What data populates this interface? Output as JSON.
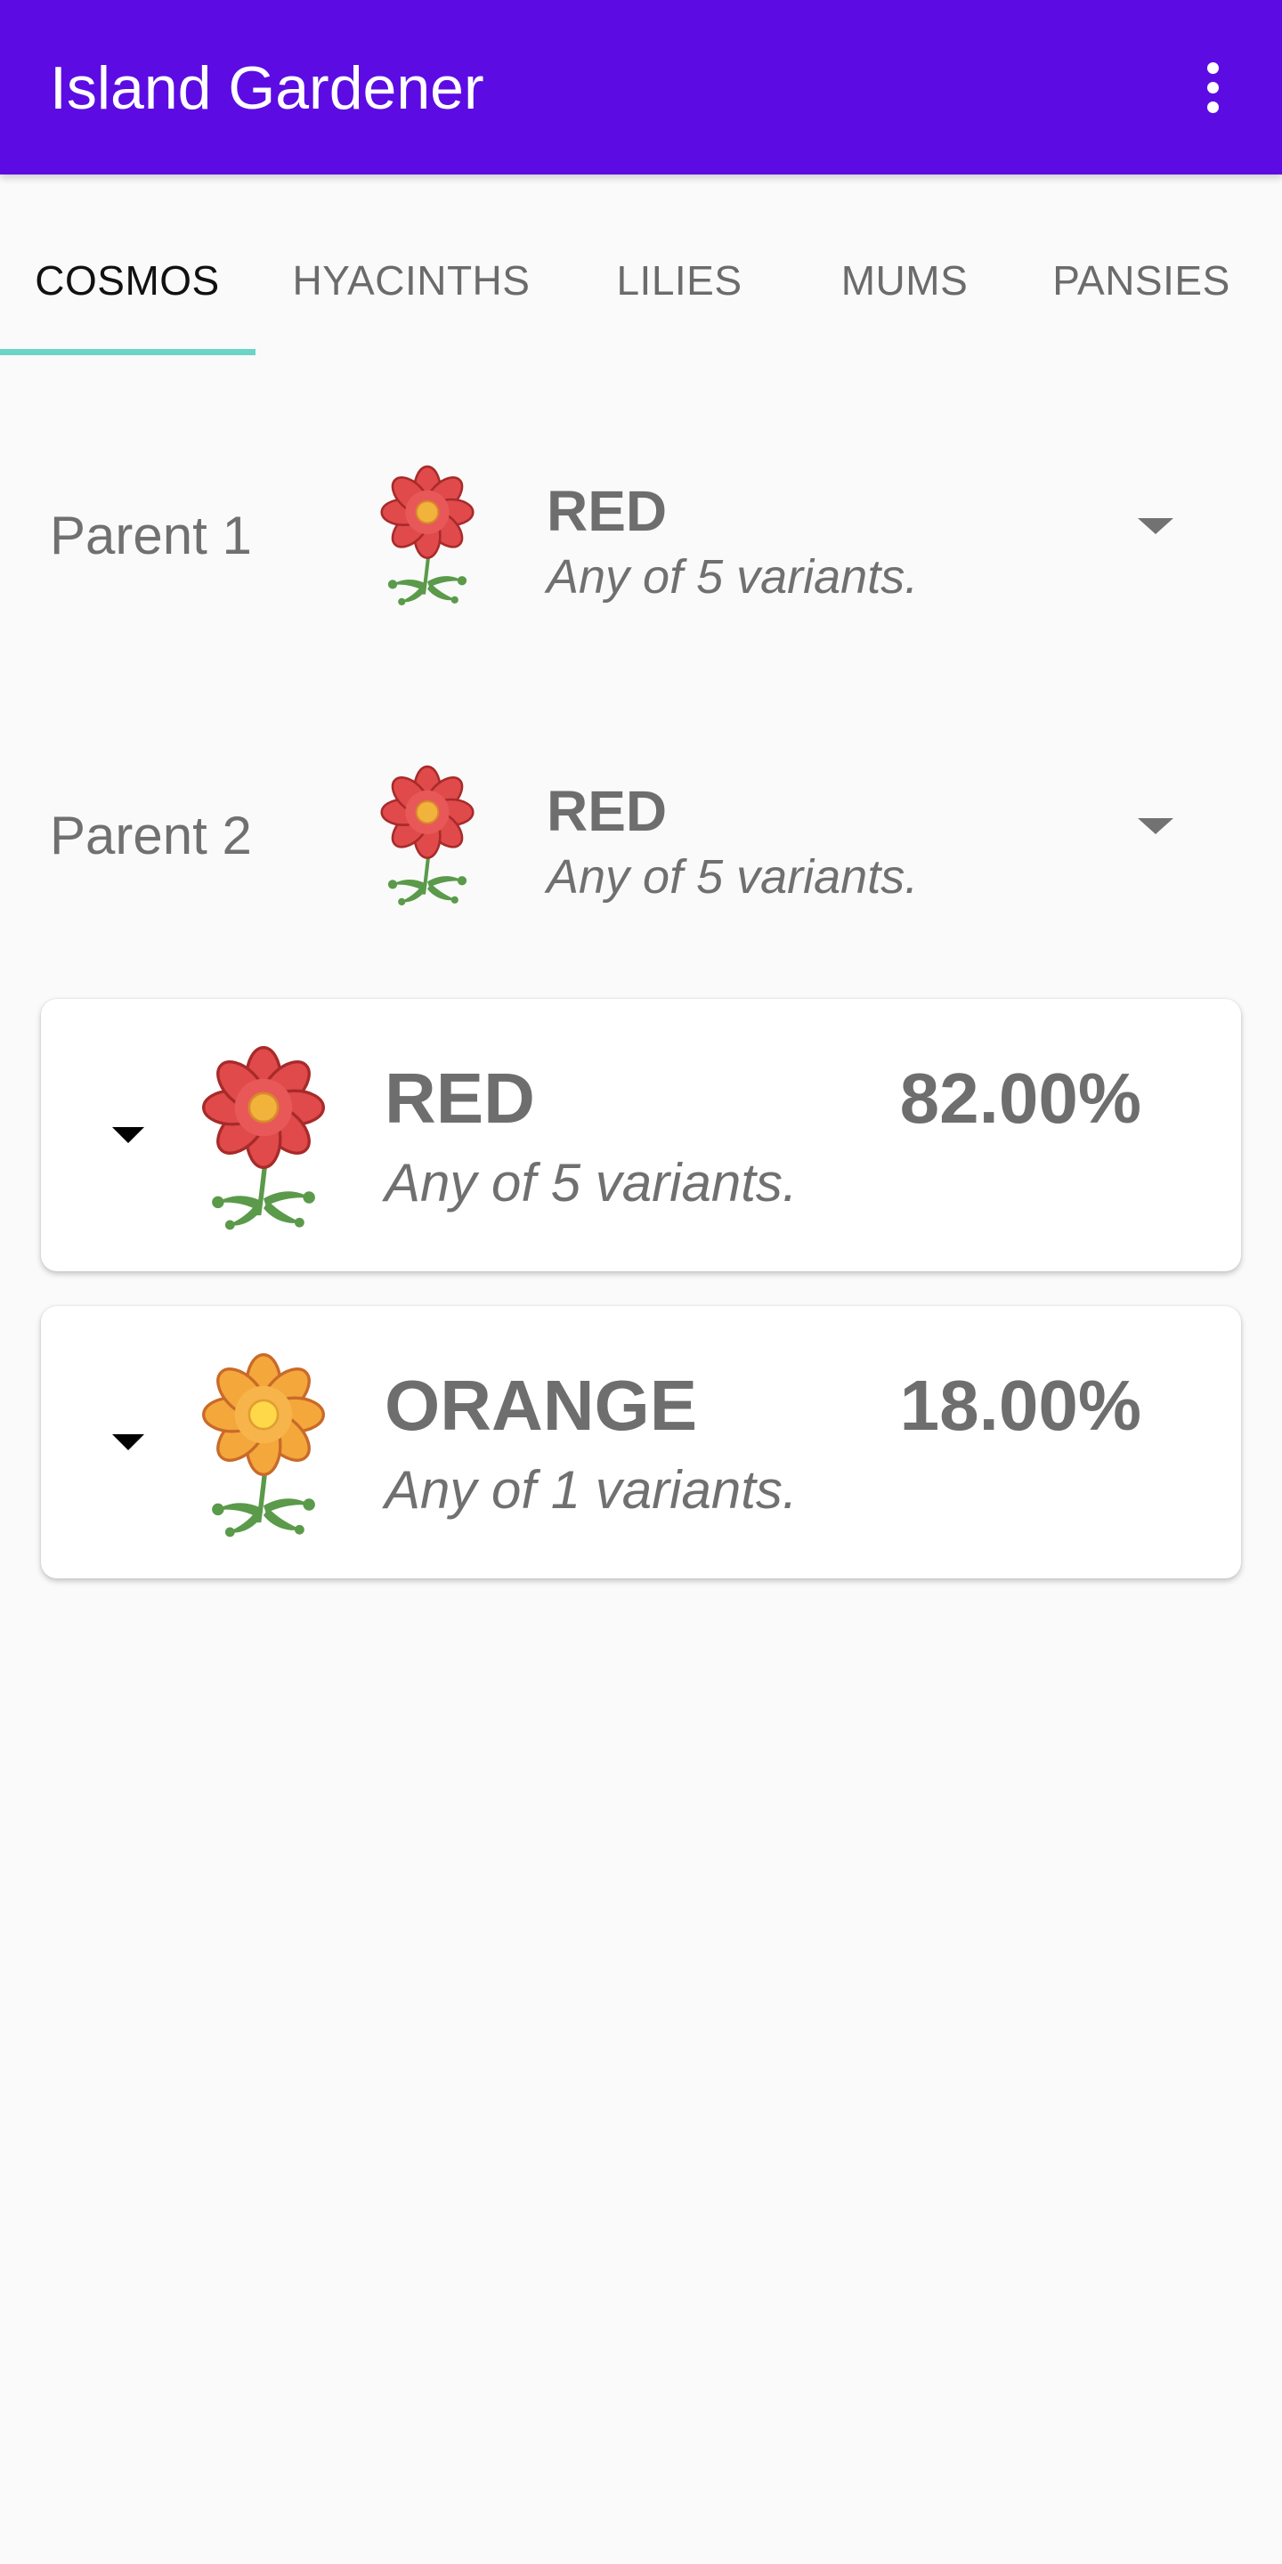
{
  "app_bar": {
    "title": "Island Gardener",
    "color": "#5C0CE3",
    "menu_icon": "more-vert-icon"
  },
  "tabs": [
    {
      "label": "COSMOS",
      "active": true
    },
    {
      "label": "HYACINTHS",
      "active": false
    },
    {
      "label": "LILIES",
      "active": false
    },
    {
      "label": "MUMS",
      "active": false
    },
    {
      "label": "PANSIES",
      "active": false
    }
  ],
  "tab_indicator_color": "#6BD4C8",
  "parents": [
    {
      "label": "Parent 1",
      "color": "RED",
      "variants": "Any of 5 variants.",
      "icon": "red-cosmos-icon"
    },
    {
      "label": "Parent 2",
      "color": "RED",
      "variants": "Any of 5 variants.",
      "icon": "red-cosmos-icon"
    }
  ],
  "results": [
    {
      "color": "RED",
      "variants": "Any of 5 variants.",
      "percent": "82.00%",
      "icon": "red-cosmos-icon"
    },
    {
      "color": "ORANGE",
      "variants": "Any of 1 variants.",
      "percent": "18.00%",
      "icon": "orange-cosmos-icon"
    }
  ],
  "flower_colors": {
    "red": {
      "petal": "#E04A4A",
      "outline": "#A82A2A",
      "center": "#F2B33D"
    },
    "orange": {
      "petal": "#F4A73B",
      "outline": "#C96A2A",
      "center": "#FFD84A"
    },
    "stem": "#5A9A4A"
  }
}
